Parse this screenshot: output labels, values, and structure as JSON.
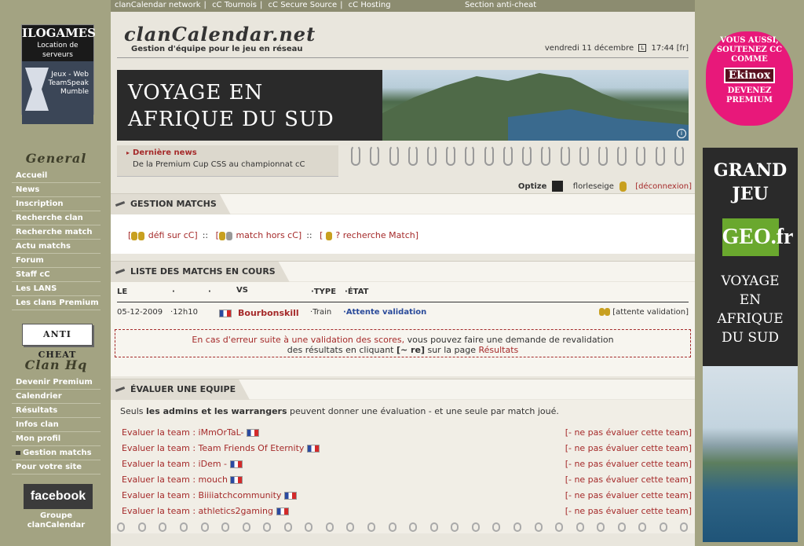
{
  "network": {
    "items": [
      "clanCalendar network",
      "cC Tournois",
      "cC Secure Source",
      "cC Hosting"
    ],
    "section": "Section anti-cheat"
  },
  "ad_left": {
    "brand": "ILOGAMES",
    "subtitle": "Location de serveurs",
    "services": [
      "Jeux - Web",
      "TeamSpeak",
      "Mumble"
    ]
  },
  "header": {
    "logo": "clanCalendar.net",
    "tagline": "Gestion d'équipe pour le jeu en réseau",
    "date": "vendredi 11 décembre",
    "time": "17:44",
    "lang": "[fr]"
  },
  "banner": {
    "line1": "VOYAGE EN",
    "line2": "AFRIQUE DU SUD",
    "info": "i"
  },
  "news": {
    "title": "Dernière news",
    "body": "De la Premium Cup CSS au championnat cC"
  },
  "user": {
    "name1": "Optize",
    "name2": "florleseige",
    "logout": "[déconnexion]"
  },
  "sidebar": {
    "general_title": "General",
    "general": [
      "Accueil",
      "News",
      "Inscription",
      "Recherche clan",
      "Recherche match",
      "Actu matchs",
      "Forum",
      "Staff cC",
      "Les LANS",
      "Les clans Premium"
    ],
    "anticheat": "ANTI CHEAT",
    "clanhq_title": "Clan Hq",
    "clanhq": [
      "Devenir Premium",
      "Calendrier",
      "Résultats",
      "Infos clan",
      "Mon profil",
      "Gestion matchs",
      "Pour votre site"
    ],
    "facebook": "facebook",
    "fb_group": "Groupe",
    "fb_group2": "clanCalendar"
  },
  "gestion": {
    "title": "GESTION MATCHS",
    "link1": "défi sur cC]",
    "link2": "match hors cC]",
    "link3": "? recherche Match]"
  },
  "liste": {
    "title": "LISTE DES MATCHS EN COURS",
    "headers": {
      "le": "LE",
      "vs": "VS",
      "type": "TYPE",
      "etat": "ÉTAT"
    },
    "row": {
      "date": "05-12-2009",
      "hour": "12h10",
      "team": "Bourbonskill",
      "type": "Train",
      "state": "Attente validation",
      "status": "[attente validation]"
    }
  },
  "error": {
    "line1a": "En cas d'erreur suite à une validation des scores,",
    "line1b": "vous pouvez faire une demande de revalidation",
    "line2a": "des résultats en cliquant",
    "line2b": "[~ re]",
    "line2c": "sur la page",
    "line2d": "Résultats"
  },
  "evaluer": {
    "title": "ÉVALUER UNE EQUIPE",
    "intro1": "Seuls ",
    "intro2": "les admins et les warrangers",
    "intro3": " peuvent donner une évaluation - et une seule par match joué.",
    "rows": [
      "Evaluer la team : iMmOrTaL-",
      "Evaluer la team : Team Friends Of Eternity",
      "Evaluer la team : iDem -",
      "Evaluer la team : mouch",
      "Evaluer la team : Biiiiatchcommunity",
      "Evaluer la team : athletics2gaming"
    ],
    "skip": "[- ne pas évaluer cette team]"
  },
  "ad_right": {
    "line1": "VOUS AUSSI,",
    "line2": "SOUTENEZ CC",
    "line3": "COMME",
    "brand": "Ekinox",
    "line4": "DEVENEZ",
    "line5": "PREMIUM"
  },
  "geo": {
    "t1": "GRAND",
    "t2": "JEU",
    "logo": "GEO.fr",
    "t3": "VOYAGE",
    "t4": "EN",
    "t5": "AFRIQUE",
    "t6": "DU SUD"
  }
}
